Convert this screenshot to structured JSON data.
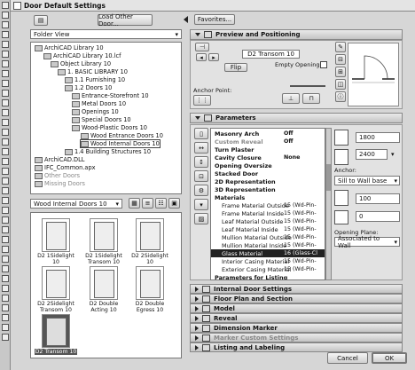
{
  "window": {
    "title": "Door Default Settings"
  },
  "top": {
    "load_btn": "Load Other Door...",
    "favorites_btn": "Favorites...",
    "view_select": "Folder View"
  },
  "tree": {
    "items": [
      {
        "label": "ArchiCAD Library 10",
        "dim": false
      },
      {
        "label": "ArchiCAD Library 10.lcf",
        "dim": false
      },
      {
        "label": "Object Library 10",
        "dim": false
      },
      {
        "label": "1. BASIC LIBRARY 10",
        "dim": false
      },
      {
        "label": "1.1 Furnishing 10",
        "dim": false
      },
      {
        "label": "1.2 Doors 10",
        "dim": false
      },
      {
        "label": "Entrance-Storefront 10",
        "dim": false
      },
      {
        "label": "Metal Doors 10",
        "dim": false
      },
      {
        "label": "Openings 10",
        "dim": false
      },
      {
        "label": "Special Doors 10",
        "dim": false
      },
      {
        "label": "Wood-Plastic Doors 10",
        "dim": false
      },
      {
        "label": "Wood Entrance Doors 10",
        "dim": false
      },
      {
        "label": "Wood Internal Doors 10",
        "dim": false
      },
      {
        "label": "1.4 Building Structures 10",
        "dim": false
      },
      {
        "label": "ArchiCAD.DLL",
        "dim": false
      },
      {
        "label": "IFC_Common.apx",
        "dim": false
      },
      {
        "label": "Other Doors",
        "dim": true
      },
      {
        "label": "Missing Doors",
        "dim": true
      }
    ]
  },
  "folder_select": "Wood Internal Doors 10",
  "thumbs": [
    {
      "label": "D2 1Sidelight 10"
    },
    {
      "label": "D2 1Sidelight Transom 10"
    },
    {
      "label": "D2 2Sidelight 10"
    },
    {
      "label": "D2 2Sidelight Transom 10"
    },
    {
      "label": "D2 Double Acting 10"
    },
    {
      "label": "D2 Double Egress 10"
    },
    {
      "label": "D2 Transom 10"
    }
  ],
  "preview": {
    "header": "Preview and Positioning",
    "name_field": "D2 Transom 10",
    "flip_btn": "Flip",
    "empty_opening": "Empty Opening",
    "anchor_point": "Anchor Point:"
  },
  "parameters": {
    "header": "Parameters",
    "rows": [
      {
        "name": "Masonry Arch",
        "value": "Off",
        "bold": true,
        "dim": false,
        "sel": false
      },
      {
        "name": "Custom Reveal",
        "value": "Off",
        "bold": true,
        "dim": true,
        "sel": false
      },
      {
        "name": "Turn Plaster",
        "value": "",
        "bold": true,
        "dim": false,
        "sel": false
      },
      {
        "name": "Cavity Closure",
        "value": "None",
        "bold": true,
        "dim": false,
        "sel": false
      },
      {
        "name": "Opening Oversize",
        "value": "",
        "bold": true,
        "dim": false,
        "sel": false
      },
      {
        "name": "Stacked Door",
        "value": "",
        "bold": true,
        "dim": false,
        "sel": false
      },
      {
        "name": "2D Representation",
        "value": "",
        "bold": true,
        "dim": false,
        "sel": false
      },
      {
        "name": "3D Representation",
        "value": "",
        "bold": true,
        "dim": false,
        "sel": false
      },
      {
        "name": "Materials",
        "value": "",
        "bold": true,
        "dim": false,
        "sel": false
      },
      {
        "name": "Frame Material Outside",
        "value": "15 (Wd-Pin-",
        "bold": false,
        "dim": false,
        "sel": false
      },
      {
        "name": "Frame Material Inside",
        "value": "15 (Wd-Pin-",
        "bold": false,
        "dim": false,
        "sel": false
      },
      {
        "name": "Leaf Material Outside",
        "value": "15 (Wd-Pin-",
        "bold": false,
        "dim": false,
        "sel": false
      },
      {
        "name": "Leaf Material Inside",
        "value": "15 (Wd-Pin-",
        "bold": false,
        "dim": false,
        "sel": false
      },
      {
        "name": "Mullion Material Outside",
        "value": "15 (Wd-Pin-",
        "bold": false,
        "dim": false,
        "sel": false
      },
      {
        "name": "Mullion Material Inside",
        "value": "15 (Wd-Pin-",
        "bold": false,
        "dim": false,
        "sel": false
      },
      {
        "name": "Glass Material",
        "value": "16 (Glass-Cl",
        "bold": false,
        "dim": false,
        "sel": true
      },
      {
        "name": "Interior Casing Material",
        "value": "15 (Wd-Pin-",
        "bold": false,
        "dim": false,
        "sel": false
      },
      {
        "name": "Exterior Casing Material",
        "value": "15 (Wd-Pin-",
        "bold": false,
        "dim": false,
        "sel": false
      },
      {
        "name": "Parameters for Listing",
        "value": "",
        "bold": true,
        "dim": false,
        "sel": false
      }
    ]
  },
  "dims": {
    "width": "1800",
    "height": "2400",
    "anchor_label": "Anchor:",
    "anchor_select": "Sill to Wall base",
    "sill": "100",
    "offset": "0",
    "opening_plane_label": "Opening Plane:",
    "opening_plane_select": "Associated to Wall"
  },
  "sections": [
    {
      "label": "Internal Door Settings",
      "dim": false
    },
    {
      "label": "Floor Plan and Section",
      "dim": false
    },
    {
      "label": "Model",
      "dim": false
    },
    {
      "label": "Reveal",
      "dim": false
    },
    {
      "label": "Dimension Marker",
      "dim": false
    },
    {
      "label": "Marker Custom Settings",
      "dim": true
    },
    {
      "label": "Listing and Labeling",
      "dim": false
    }
  ],
  "footer": {
    "cancel": "Cancel",
    "ok": "OK"
  }
}
